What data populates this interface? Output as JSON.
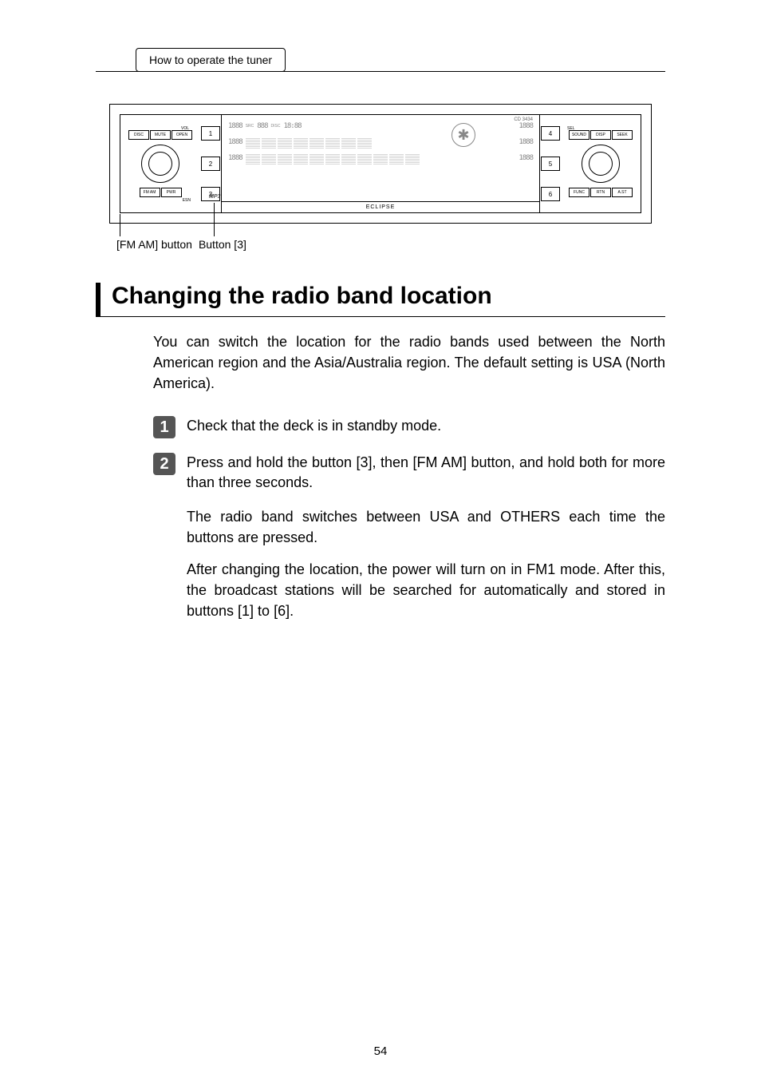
{
  "header": {
    "tab_label": "How to operate the tuner"
  },
  "figure": {
    "model": "CD 3434",
    "brand": "ECLIPSE",
    "mp3": "MP3",
    "left_top_buttons": [
      "DISC",
      "MUTE",
      "OPEN"
    ],
    "left_bottom_buttons": [
      "FM AM",
      "PWR"
    ],
    "right_top_buttons": [
      "SOUND",
      "DISP",
      "SEEK"
    ],
    "right_bottom_buttons": [
      "FUNC",
      "RTN",
      "A.ST"
    ],
    "vol_label": "VOL",
    "esn_label": "ESN",
    "sel_label": "SEL",
    "left_presets": [
      "1",
      "2",
      "3"
    ],
    "right_presets": [
      "4",
      "5",
      "6"
    ],
    "lcd_top_small": [
      "SRC",
      "DISC"
    ],
    "lcd_segments_1": "1888",
    "lcd_segments_top": "888",
    "lcd_time": "18:88",
    "lcd_segments_2": "1888",
    "lcd_segments_3": "1888",
    "lcd_right_1": "1888",
    "lcd_right_2": "1888",
    "lcd_right_3": "1888"
  },
  "callouts": {
    "fm_am": "[FM AM] button",
    "button3": "Button [3]"
  },
  "title": "Changing the radio band location",
  "intro": "You can switch the location for the radio bands used between the North American region and the Asia/Australia region. The default setting is USA (North America).",
  "steps": [
    {
      "num": "1",
      "text": "Check that the deck is in standby mode."
    },
    {
      "num": "2",
      "text": "Press and hold the button [3], then [FM AM] button, and hold both for more than three seconds."
    }
  ],
  "note1": "The radio band switches between USA and OTHERS each time the buttons are pressed.",
  "note2": "After changing the location, the power will turn on in FM1 mode. After this, the broadcast stations will be searched for automatically and stored in buttons [1] to [6].",
  "page_number": "54"
}
